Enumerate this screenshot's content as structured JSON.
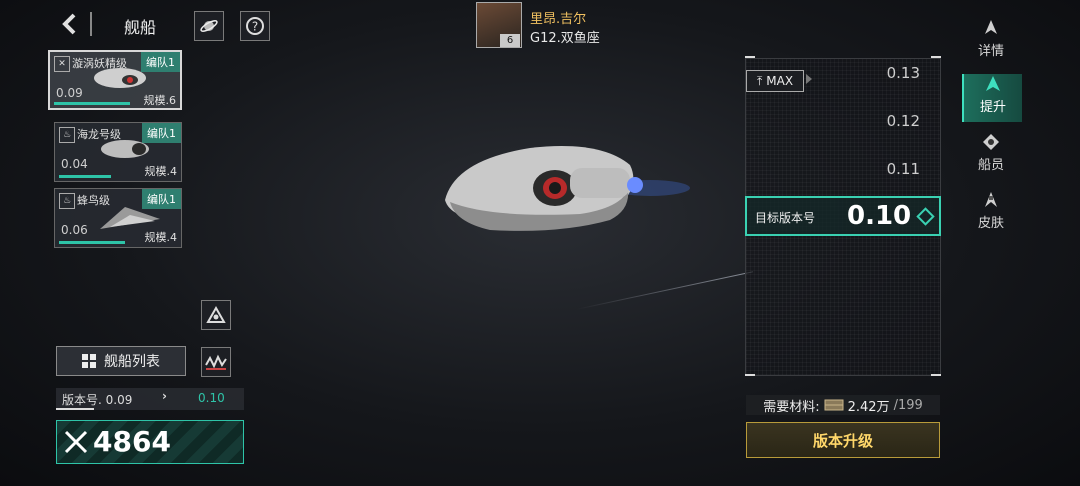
{
  "header": {
    "back_icon": "chevron-left-icon",
    "title": "舰船",
    "planet_icon": "planet-icon",
    "help_icon": "question-icon"
  },
  "player": {
    "name": "里昂.吉尔",
    "level": "6",
    "galaxy": "G12.双鱼座"
  },
  "ships": [
    {
      "name": "漩涡妖精级",
      "fleet": "编队1",
      "version": "0.09",
      "scale": "规模.6",
      "active": true
    },
    {
      "name": "海龙号级",
      "fleet": "编队1",
      "version": "0.04",
      "scale": "规模.4",
      "active": false
    },
    {
      "name": "蜂鸟级",
      "fleet": "编队1",
      "version": "0.06",
      "scale": "规模.4",
      "active": false
    }
  ],
  "tabs": [
    {
      "label": "详情",
      "icon": "ship-icon",
      "active": false
    },
    {
      "label": "提升",
      "icon": "upgrade-ship-icon",
      "active": true
    },
    {
      "label": "船员",
      "icon": "crew-icon",
      "active": false
    },
    {
      "label": "皮肤",
      "icon": "skin-icon",
      "active": false
    }
  ],
  "upgrade_panel": {
    "max_label": "MAX",
    "versions": [
      "0.13",
      "0.12",
      "0.11"
    ],
    "target_label": "目标版本号",
    "target_value": "0.10",
    "materials_label": "需要材料:",
    "materials_value": "2.42万",
    "materials_total": "/199",
    "upgrade_button": "版本升级"
  },
  "bottom": {
    "list_button": "舰船列表",
    "version_label": "版本号. 0.09",
    "version_next": "0.10",
    "power": "4864"
  },
  "colors": {
    "accent": "#2ec4a8",
    "gold": "#ffd76a"
  }
}
